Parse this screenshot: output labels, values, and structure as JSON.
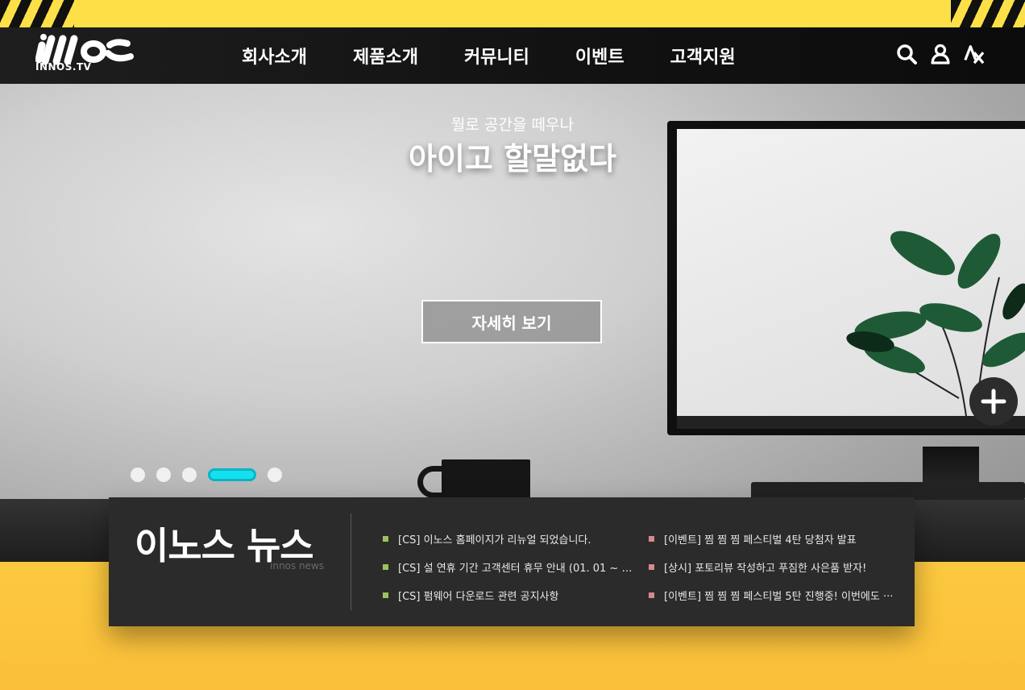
{
  "brand": {
    "logo_text": "innos",
    "logo_sub": "INNOS.TV"
  },
  "nav": {
    "items": [
      {
        "label": "회사소개"
      },
      {
        "label": "제품소개"
      },
      {
        "label": "커뮤니티"
      },
      {
        "label": "이벤트"
      },
      {
        "label": "고객지원"
      }
    ],
    "icons": [
      "search-icon",
      "user-icon",
      "translate-icon"
    ]
  },
  "hero": {
    "subtitle": "뭘로 공간을 떼우나",
    "title": "아이고 할말없다",
    "button_label": "자세히 보기",
    "slides_total": 5,
    "active_slide": 4
  },
  "news": {
    "title": "이노스 뉴스",
    "subtitle": "innos news",
    "left_items": [
      {
        "text": "[CS] 이노스 홈페이지가 리뉴얼 되었습니다."
      },
      {
        "text": "[CS] 설 연휴 기간 고객센터 휴무 안내 (01. 01 ~ 0···"
      },
      {
        "text": "[CS] 펌웨어 다운로드 관련 공지사항"
      }
    ],
    "right_items": [
      {
        "text": "[이벤트] 찜 찜 찜 페스티벌 4탄 당첨자 발표"
      },
      {
        "text": "[상시] 포토리뷰 작성하고 푸짐한 사은품 받자!"
      },
      {
        "text": "[이벤트] 찜 찜 찜 페스티벌 5탄 진행중! 이번에도 ···"
      }
    ]
  },
  "colors": {
    "accent_yellow": "#fde047",
    "nav_bg": "#111111",
    "active_dot": "#16e0ef",
    "bullet_green": "#9cc35a",
    "bullet_pink": "#d68a8a",
    "panel_bg": "#2b2b2b"
  }
}
